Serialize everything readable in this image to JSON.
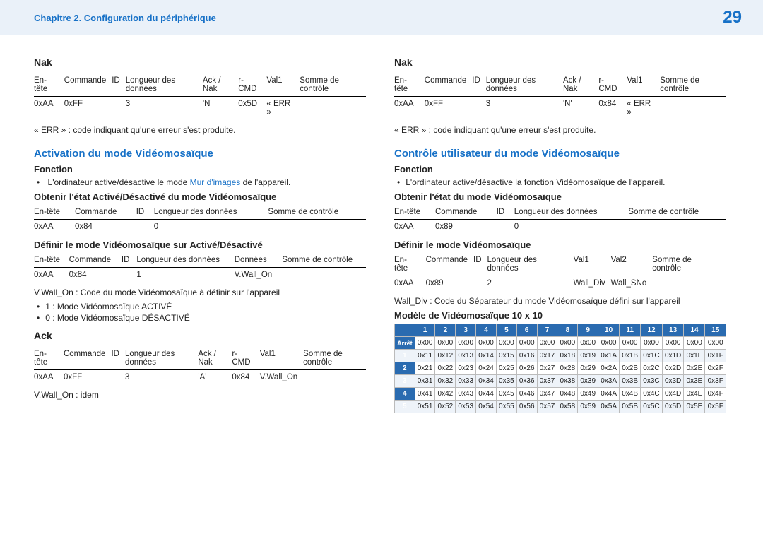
{
  "header": {
    "chapter": "Chapitre 2. Configuration du périphérique",
    "page": "29"
  },
  "left": {
    "nak_title": "Nak",
    "nak_headers": [
      "En-tête",
      "Commande",
      "ID",
      "Longueur des données",
      "Ack / Nak",
      "r-CMD",
      "Val1",
      "Somme de contrôle"
    ],
    "nak_row": [
      "0xAA",
      "0xFF",
      "",
      "3",
      "'N'",
      "0x5D",
      "« ERR »",
      ""
    ],
    "err_note": "« ERR » : code indiquant qu'une erreur s'est produite.",
    "activation_title": "Activation du mode Vidéomosaïque",
    "fn_title": "Fonction",
    "fn_text_pre": "L'ordinateur active/désactive le mode ",
    "fn_link": "Mur d'images",
    "fn_text_post": " de l'appareil.",
    "get_title": "Obtenir l'état Activé/Désactivé du mode Vidéomosaïque",
    "get_headers": [
      "En-tête",
      "Commande",
      "ID",
      "Longueur des données",
      "Somme de contrôle"
    ],
    "get_row": [
      "0xAA",
      "0x84",
      "",
      "0",
      ""
    ],
    "set_title": "Définir le mode Vidéomosaïque sur Activé/Désactivé",
    "set_headers": [
      "En-tête",
      "Commande",
      "ID",
      "Longueur des données",
      "Données",
      "Somme de contrôle"
    ],
    "set_row": [
      "0xAA",
      "0x84",
      "",
      "1",
      "V.Wall_On",
      ""
    ],
    "vwall_note": "V.Wall_On : Code du mode Vidéomosaïque à définir sur l'appareil",
    "mode_on": "1 : Mode Vidéomosaïque ACTIVÉ",
    "mode_off": "0 : Mode Vidéomosaïque DÉSACTIVÉ",
    "ack_title": "Ack",
    "ack_headers": [
      "En-tête",
      "Commande",
      "ID",
      "Longueur des données",
      "Ack / Nak",
      "r-CMD",
      "Val1",
      "Somme de contrôle"
    ],
    "ack_row": [
      "0xAA",
      "0xFF",
      "",
      "3",
      "'A'",
      "0x84",
      "V.Wall_On",
      ""
    ],
    "idem": "V.Wall_On : idem"
  },
  "right": {
    "nak_title": "Nak",
    "nak_headers": [
      "En-tête",
      "Commande",
      "ID",
      "Longueur des données",
      "Ack / Nak",
      "r-CMD",
      "Val1",
      "Somme de contrôle"
    ],
    "nak_row": [
      "0xAA",
      "0xFF",
      "",
      "3",
      "'N'",
      "0x84",
      "« ERR »",
      ""
    ],
    "err_note": "« ERR » : code indiquant qu'une erreur s'est produite.",
    "ctrl_title": "Contrôle utilisateur du mode Vidéomosaïque",
    "fn_title": "Fonction",
    "fn_text": "L'ordinateur active/désactive la fonction Vidéomosaïque de l'appareil.",
    "get_title": "Obtenir l'état du mode Vidéomosaïque",
    "get_headers": [
      "En-tête",
      "Commande",
      "ID",
      "Longueur des données",
      "Somme de contrôle"
    ],
    "get_row": [
      "0xAA",
      "0x89",
      "",
      "0",
      ""
    ],
    "set_title": "Définir le mode Vidéomosaïque",
    "set_headers": [
      "En-tête",
      "Commande",
      "ID",
      "Longueur des données",
      "Val1",
      "Val2",
      "Somme de contrôle"
    ],
    "set_row": [
      "0xAA",
      "0x89",
      "",
      "2",
      "Wall_Div",
      "Wall_SNo",
      ""
    ],
    "wall_note": "Wall_Div : Code du Séparateur du mode Vidéomosaïque défini sur l'appareil",
    "model_title": "Modèle de Vidéomosaïque 10 x 10",
    "grid_header_first": "",
    "grid_cols": [
      "1",
      "2",
      "3",
      "4",
      "5",
      "6",
      "7",
      "8",
      "9",
      "10",
      "11",
      "12",
      "13",
      "14",
      "15"
    ],
    "grid_rows": [
      {
        "label": "Arrêt",
        "cells": [
          "0x00",
          "0x00",
          "0x00",
          "0x00",
          "0x00",
          "0x00",
          "0x00",
          "0x00",
          "0x00",
          "0x00",
          "0x00",
          "0x00",
          "0x00",
          "0x00",
          "0x00"
        ]
      },
      {
        "label": "1",
        "cells": [
          "0x11",
          "0x12",
          "0x13",
          "0x14",
          "0x15",
          "0x16",
          "0x17",
          "0x18",
          "0x19",
          "0x1A",
          "0x1B",
          "0x1C",
          "0x1D",
          "0x1E",
          "0x1F"
        ]
      },
      {
        "label": "2",
        "cells": [
          "0x21",
          "0x22",
          "0x23",
          "0x24",
          "0x25",
          "0x26",
          "0x27",
          "0x28",
          "0x29",
          "0x2A",
          "0x2B",
          "0x2C",
          "0x2D",
          "0x2E",
          "0x2F"
        ]
      },
      {
        "label": "3",
        "cells": [
          "0x31",
          "0x32",
          "0x33",
          "0x34",
          "0x35",
          "0x36",
          "0x37",
          "0x38",
          "0x39",
          "0x3A",
          "0x3B",
          "0x3C",
          "0x3D",
          "0x3E",
          "0x3F"
        ]
      },
      {
        "label": "4",
        "cells": [
          "0x41",
          "0x42",
          "0x43",
          "0x44",
          "0x45",
          "0x46",
          "0x47",
          "0x48",
          "0x49",
          "0x4A",
          "0x4B",
          "0x4C",
          "0x4D",
          "0x4E",
          "0x4F"
        ]
      },
      {
        "label": "5",
        "cells": [
          "0x51",
          "0x52",
          "0x53",
          "0x54",
          "0x55",
          "0x56",
          "0x57",
          "0x58",
          "0x59",
          "0x5A",
          "0x5B",
          "0x5C",
          "0x5D",
          "0x5E",
          "0x5F"
        ]
      }
    ]
  }
}
